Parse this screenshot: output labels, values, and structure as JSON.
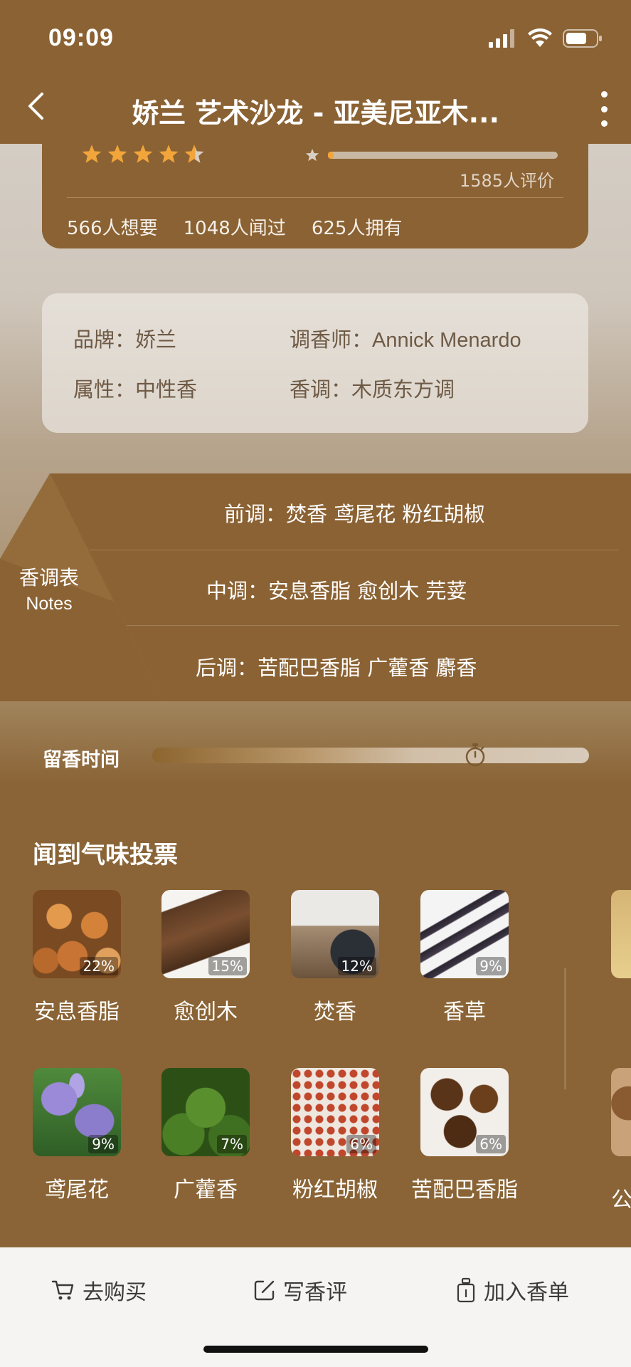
{
  "status_bar": {
    "time": "09:09"
  },
  "nav": {
    "title": "娇兰 艺术沙龙 - 亚美尼亚木..."
  },
  "rating": {
    "stars": 4.5,
    "review_count": "1585人评价",
    "distribution_fill": 0.01
  },
  "stats": {
    "want": "566人想要",
    "smelled": "1048人闻过",
    "own": "625人拥有"
  },
  "info": {
    "brand_label": "品牌：",
    "brand_value": "娇兰",
    "perfumer_label": "调香师：",
    "perfumer_value": "Annick Menardo",
    "gender_label": "属性：",
    "gender_value": "中性香",
    "family_label": "香调：",
    "family_value": "木质东方调"
  },
  "notes": {
    "label_zh": "香调表",
    "label_en": "Notes",
    "top": "前调：焚香 鸢尾花 粉红胡椒",
    "middle": "中调：安息香脂 愈创木 芫荽",
    "base": "后调：苦配巴香脂 广藿香 麝香"
  },
  "longevity": {
    "label": "留香时间",
    "level": 0.74
  },
  "votes": {
    "title": "闻到气味投票",
    "row1": [
      {
        "name": "安息香脂",
        "pct": "22%"
      },
      {
        "name": "愈创木",
        "pct": "15%"
      },
      {
        "name": "焚香",
        "pct": "12%"
      },
      {
        "name": "香草",
        "pct": "9%"
      }
    ],
    "row2": [
      {
        "name": "鸢尾花",
        "pct": "9%"
      },
      {
        "name": "广藿香",
        "pct": "7%"
      },
      {
        "name": "粉红胡椒",
        "pct": "6%"
      },
      {
        "name": "苦配巴香脂",
        "pct": "6%"
      }
    ],
    "row2_peek_name": "公"
  },
  "bottom": {
    "buy": "去购买",
    "review": "写香评",
    "add_list": "加入香单"
  },
  "colors": {
    "brand_brown": "#8b6233",
    "star": "#f2a53a"
  }
}
